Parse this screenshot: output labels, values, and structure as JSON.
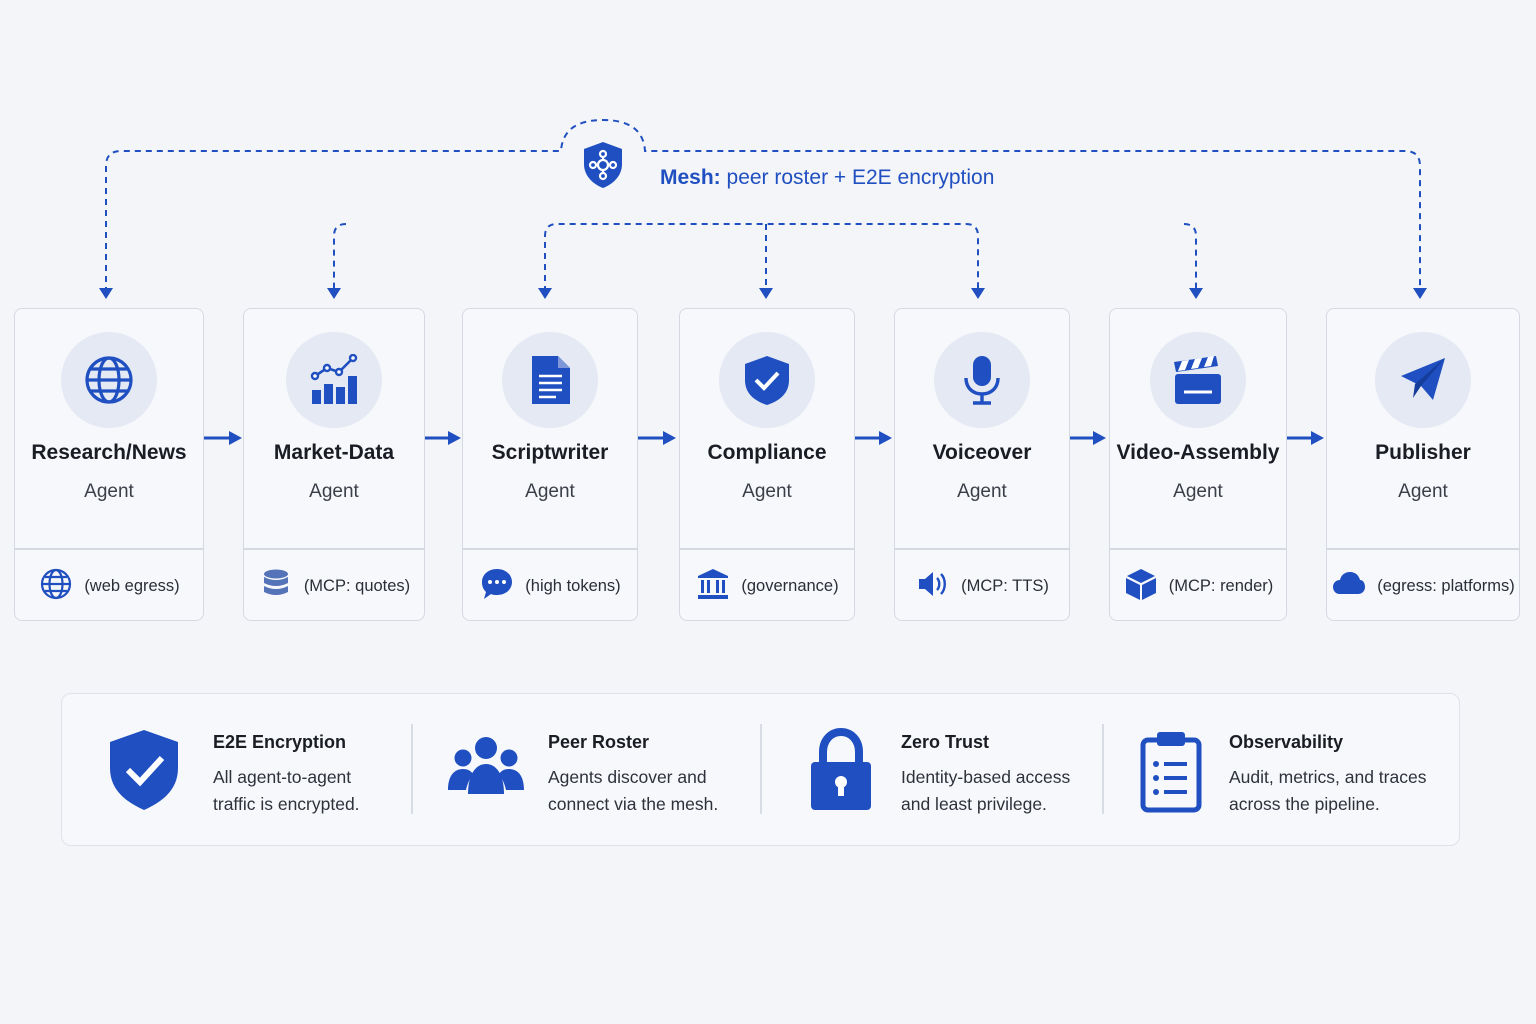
{
  "mesh": {
    "label_bold": "Mesh:",
    "label_rest": " peer roster + E2E encryption",
    "icon": "shield-network-icon"
  },
  "agents": [
    {
      "name": "Research/News",
      "role": "Agent",
      "icon": "globe-icon",
      "tag": "(web egress)",
      "tag_icon": "globe-icon"
    },
    {
      "name": "Market-Data",
      "role": "Agent",
      "icon": "bar-chart-icon",
      "tag": "(MCP: quotes)",
      "tag_icon": "database-icon"
    },
    {
      "name": "Scriptwriter",
      "role": "Agent",
      "icon": "document-icon",
      "tag": "(high tokens)",
      "tag_icon": "chat-bubble-icon"
    },
    {
      "name": "Compliance",
      "role": "Agent",
      "icon": "shield-check-icon",
      "tag": "(governance)",
      "tag_icon": "institution-icon"
    },
    {
      "name": "Voiceover",
      "role": "Agent",
      "icon": "microphone-icon",
      "tag": "(MCP: TTS)",
      "tag_icon": "speaker-icon"
    },
    {
      "name": "Video-Assembly",
      "role": "Agent",
      "icon": "clapperboard-icon",
      "tag": "(MCP: render)",
      "tag_icon": "cube-icon"
    },
    {
      "name": "Publisher",
      "role": "Agent",
      "icon": "paper-plane-icon",
      "tag": "(egress: platforms)",
      "tag_icon": "cloud-icon"
    }
  ],
  "features": [
    {
      "title": "E2E Encryption",
      "desc": "All agent-to-agent traffic is encrypted.",
      "icon": "shield-check-icon"
    },
    {
      "title": "Peer Roster",
      "desc": "Agents discover and connect via the mesh.",
      "icon": "people-group-icon"
    },
    {
      "title": "Zero Trust",
      "desc": "Identity-based access and least privilege.",
      "icon": "padlock-icon"
    },
    {
      "title": "Observability",
      "desc": "Audit, metrics, and traces across the pipeline.",
      "icon": "clipboard-list-icon"
    }
  ],
  "colors": {
    "accent": "#1f4fc0",
    "icon_bg": "#e4e9f4",
    "card_border": "#d5d9e2",
    "background": "#f4f5f8"
  }
}
